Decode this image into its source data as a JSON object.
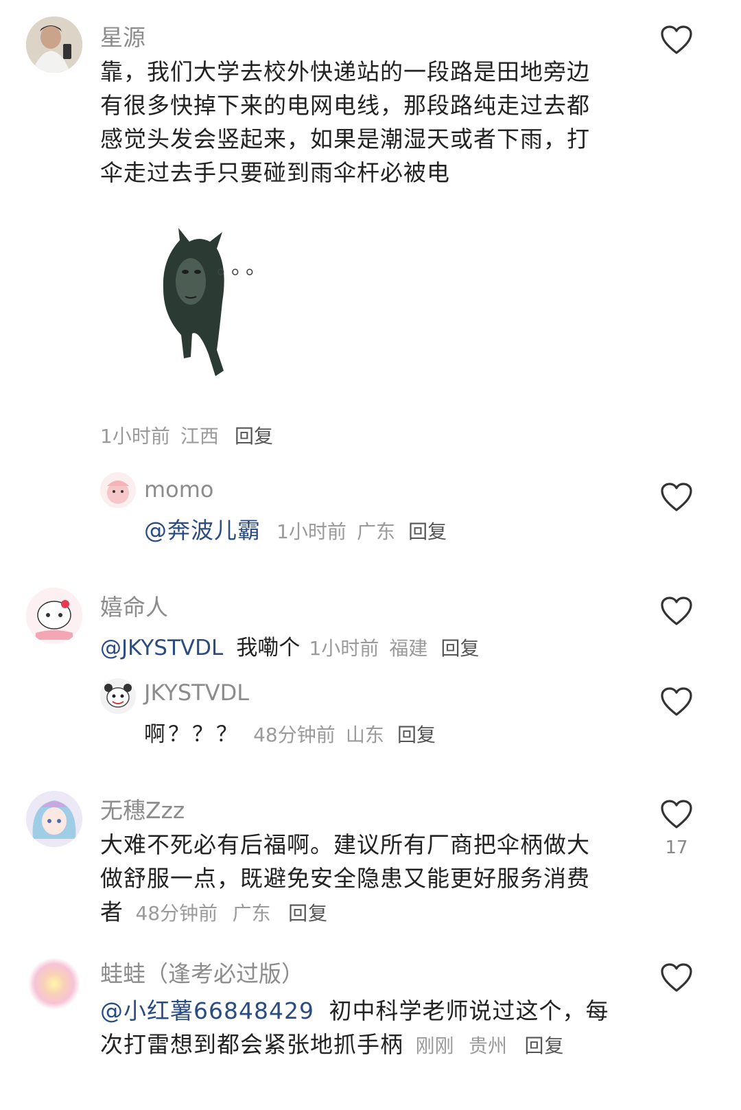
{
  "comments": [
    {
      "username": "星源",
      "text": "靠，我们大学去校外快递站的一段路是田地旁边有很多快掉下来的电网电线，那段路纯走过去都感觉头发会竖起来，如果是潮湿天或者下雨，打伞走过去手只要碰到雨伞杆必被电",
      "lines": [
        "靠，我们大学去校外快递站的一段路是田地旁边",
        "有很多快掉下来的电网电线，那段路纯走过去都",
        "感觉头发会竖起来，如果是潮湿天或者下雨，打",
        "伞走过去手只要碰到雨伞杆必被电"
      ],
      "sticker_dots": "。。。",
      "time": "1小时前",
      "location": "江西",
      "reply_label": "回复"
    },
    {
      "username": "momo",
      "mention": "@奔波儿霸",
      "time": "1小时前",
      "location": "广东",
      "reply_label": "回复"
    },
    {
      "username": "嬉命人",
      "mention": "@JKYSTVDL",
      "text": "我嘞个",
      "time": "1小时前",
      "location": "福建",
      "reply_label": "回复"
    },
    {
      "username": "JKYSTVDL",
      "text": "啊？？？",
      "time": "48分钟前",
      "location": "山东",
      "reply_label": "回复"
    },
    {
      "username": "无穗Zzz",
      "lines": [
        "大难不死必有后福啊。建议所有厂商把伞柄做大",
        "做舒服一点，既避免安全隐患又能更好服务消费",
        "者"
      ],
      "time": "48分钟前",
      "location": "广东",
      "reply_label": "回复",
      "likes": "17"
    },
    {
      "username": "蛙蛙（逢考必过版）",
      "mention": "@小红薯66848429",
      "line1_rest": "初中科学老师说过这个，每",
      "line2": "次打雷想到都会紧张地抓手柄",
      "time": "刚刚",
      "location": "贵州",
      "reply_label": "回复"
    }
  ]
}
